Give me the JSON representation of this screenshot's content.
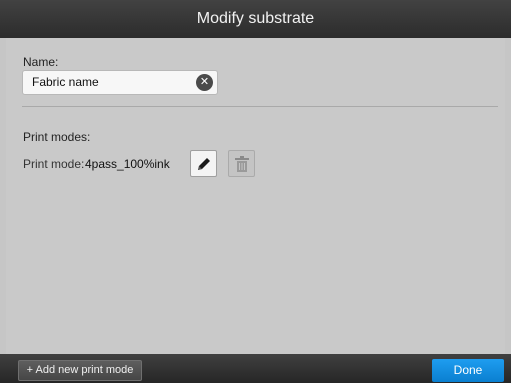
{
  "dialog": {
    "title": "Modify substrate"
  },
  "name": {
    "label": "Name:",
    "value": "Fabric name"
  },
  "print_modes": {
    "section_label": "Print modes:",
    "mode_label": "Print mode:",
    "mode_value": "4pass_100%ink"
  },
  "footer": {
    "add_label": "+ Add new print mode",
    "done_label": "Done"
  },
  "icons": {
    "clear": "close-circle-icon",
    "edit": "pencil-icon",
    "delete": "trash-icon"
  },
  "colors": {
    "accent": "#0a8ee0",
    "titlebar": "#333333",
    "panel": "#c9c9c9"
  }
}
